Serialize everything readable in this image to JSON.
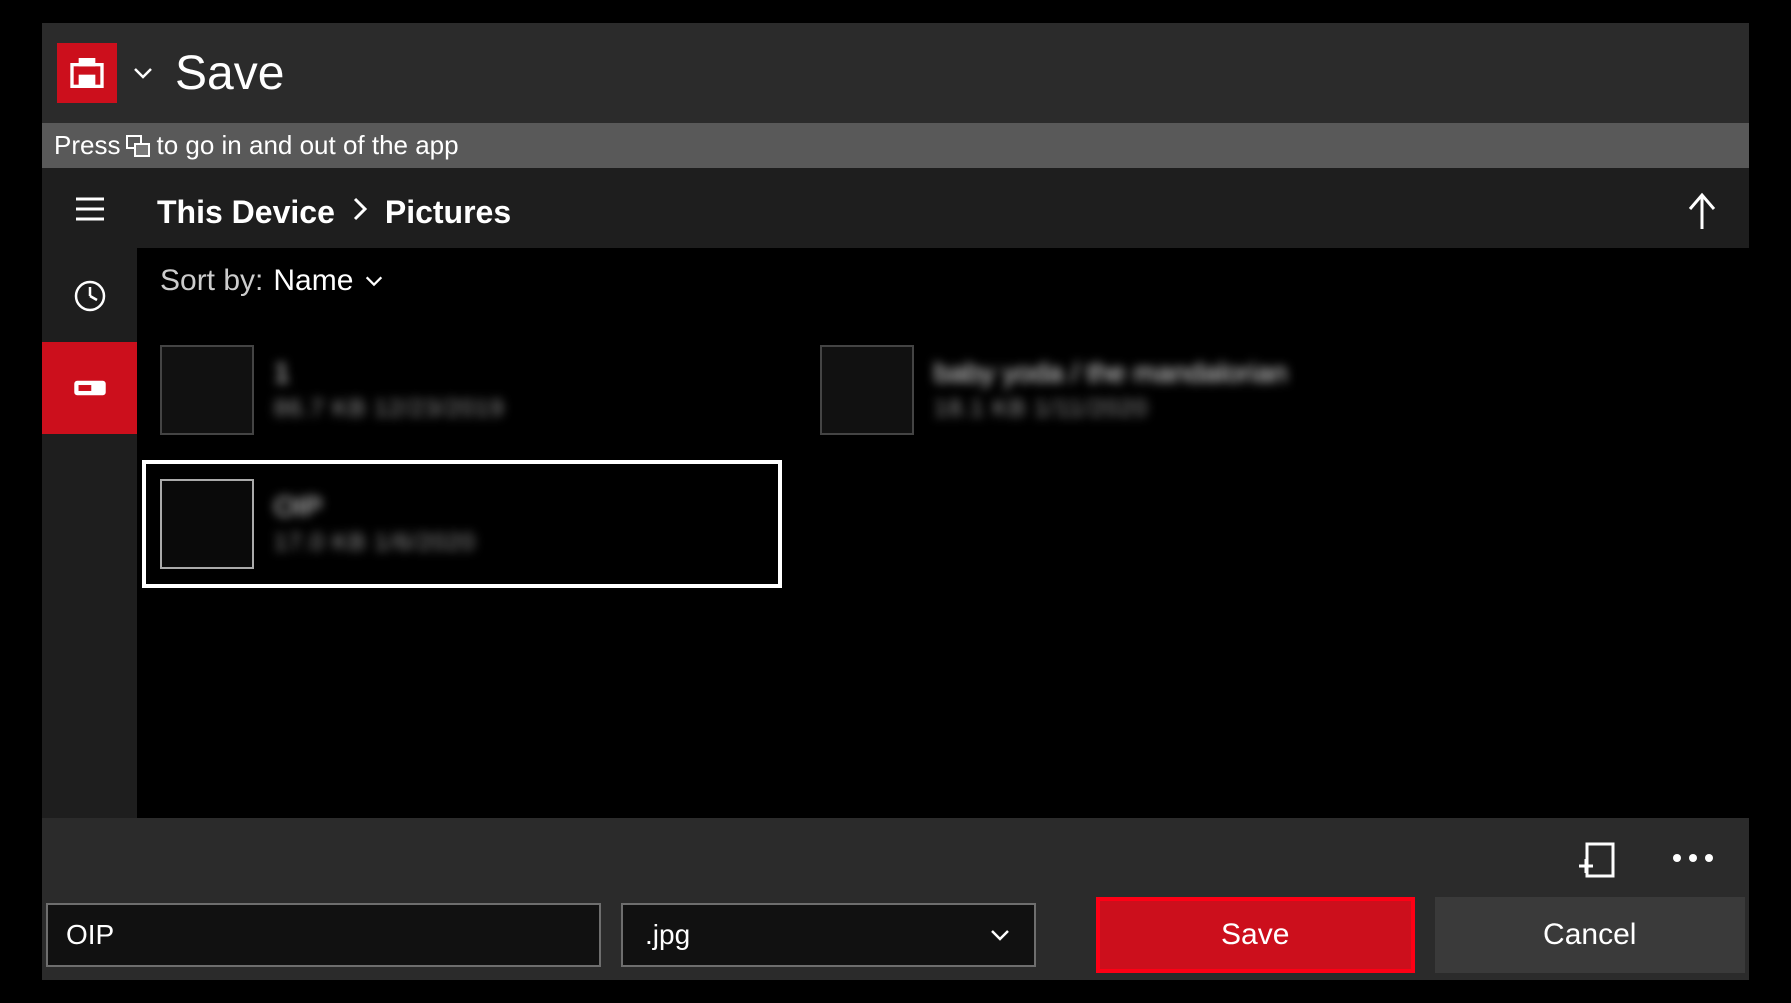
{
  "title": "Save",
  "tip": {
    "prefix": "Press",
    "suffix": "to go in and out of the app"
  },
  "breadcrumb": [
    "This Device",
    "Pictures"
  ],
  "sort": {
    "label": "Sort by:",
    "value": "Name"
  },
  "files": [
    {
      "name": "1",
      "sub": "86.7 KB  12/23/2019"
    },
    {
      "name": "baby yoda / the mandalorian",
      "sub": "18.1 KB  1/11/2020"
    },
    {
      "name": "OIP",
      "sub": "17.0 KB  1/6/2020"
    }
  ],
  "filename": "OIP",
  "extension": ".jpg",
  "buttons": {
    "save": "Save",
    "cancel": "Cancel"
  }
}
